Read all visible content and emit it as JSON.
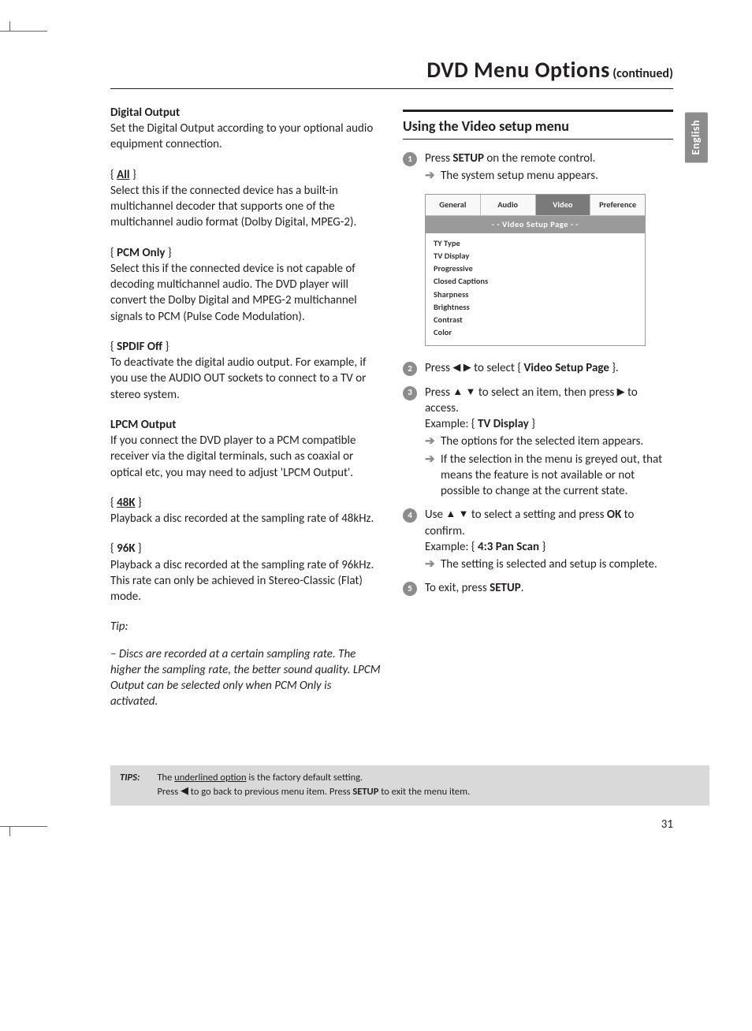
{
  "title": {
    "main": "DVD Menu Options",
    "suffix": "(continued)"
  },
  "left": {
    "h1": "Digital Output",
    "p1": "Set the Digital Output according to your optional audio equipment connection.",
    "opt1_label": "All",
    "opt1_body": "Select this if the connected device has a built-in multichannel decoder that supports one of the multichannel audio format (Dolby Digital, MPEG-2).",
    "opt2_label": "PCM Only",
    "opt2_body": "Select this if the connected device is not capable of decoding multichannel audio. The DVD player will convert the Dolby Digital and MPEG-2 multichannel signals to PCM (Pulse Code Modulation).",
    "opt3_label": "SPDIF Off",
    "opt3_body": "To deactivate the digital audio output. For example, if you use the AUDIO OUT sockets to connect to a TV or stereo system.",
    "h2": "LPCM Output",
    "p2": "If you connect the DVD player to a PCM compatible receiver via the digital terminals, such as coaxial or optical etc, you may need to adjust 'LPCM Output'.",
    "opt4_label": "48K",
    "opt4_body": "Playback a disc recorded at the sampling rate of 48kHz.",
    "opt5_label": "96K",
    "opt5_body": "Playback a disc recorded at the sampling rate of 96kHz. This rate can only be achieved in Stereo-Classic (Flat) mode.",
    "tip_label": "Tip:",
    "tip_body": "– Discs are recorded at a certain sampling rate. The higher the sampling rate, the better sound quality. LPCM Output can be selected only when PCM Only is activated."
  },
  "right": {
    "heading": "Using the Video setup menu",
    "step1_a": "Press ",
    "step1_b": "SETUP",
    "step1_c": " on the remote control.",
    "step1_sub": "The system setup menu appears.",
    "osd": {
      "tabs": [
        "General",
        "Audio",
        "Video",
        "Preference"
      ],
      "active": 2,
      "banner": "- -   Video Setup Page   - -",
      "items": [
        "TY Type",
        "TV Display",
        "Progressive",
        "Closed Captions",
        "Sharpness",
        "Brightness",
        "Contrast",
        "Color"
      ]
    },
    "step2_a": "Press ",
    "step2_b": " to select { ",
    "step2_c": "Video Setup Page",
    "step2_d": " }.",
    "step3_a": "Press ",
    "step3_b": " to select an item, then press ",
    "step3_c": " to access.",
    "step3_ex_a": "Example: { ",
    "step3_ex_b": "TV Display",
    "step3_ex_c": " }",
    "step3_sub1": "The options for the selected item appears.",
    "step3_sub2": "If the selection in the menu is greyed out, that means the feature is not available or not possible to change at the current state.",
    "step4_a": "Use ",
    "step4_b": " to select a setting and press ",
    "step4_c": "OK",
    "step4_d": " to confirm.",
    "step4_ex_a": "Example: { ",
    "step4_ex_b": "4:3 Pan Scan",
    "step4_ex_c": " }",
    "step4_sub": "The setting is selected and setup is complete.",
    "step5_a": "To exit, press ",
    "step5_b": "SETUP",
    "step5_c": "."
  },
  "lang_tab": "English",
  "tips": {
    "label": "TIPS:",
    "line1_a": "The ",
    "line1_b": "underlined option",
    "line1_c": " is the factory default setting.",
    "line2_a": "Press ",
    "line2_b": " to go back to previous menu item. Press ",
    "line2_c": "SETUP",
    "line2_d": " to exit the menu item."
  },
  "page_number": "31"
}
